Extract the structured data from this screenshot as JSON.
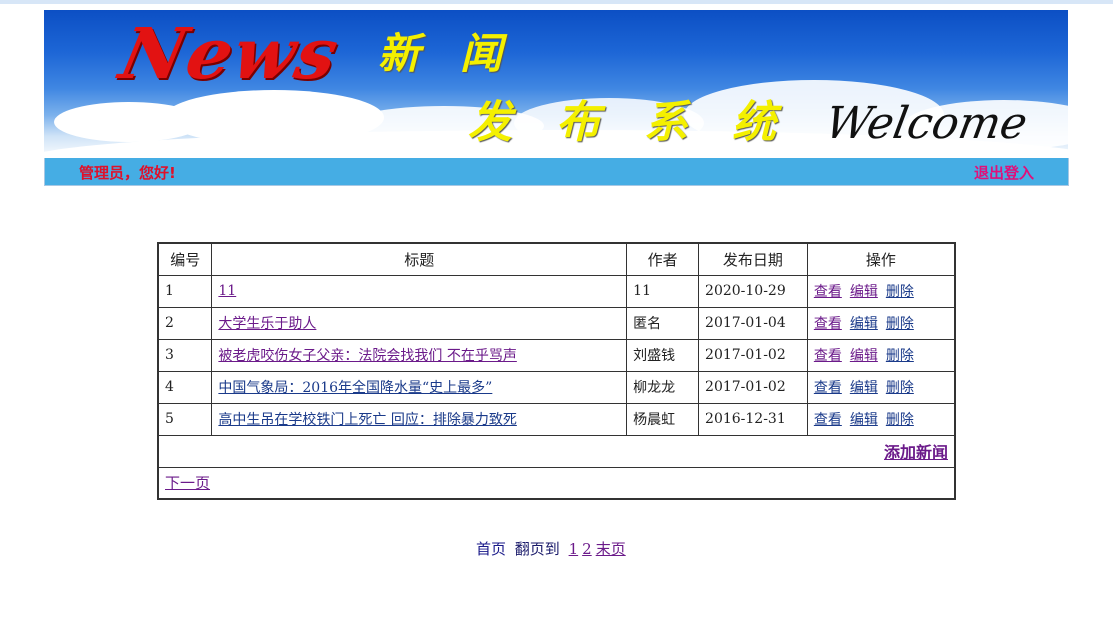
{
  "header": {
    "logo_text": "News",
    "title_line1": [
      "新",
      "闻"
    ],
    "title_line2": [
      "发",
      "布",
      "系",
      "统"
    ],
    "welcome_text": "Welcome"
  },
  "userbar": {
    "greeting": "管理员，您好!",
    "logout": "退出登入"
  },
  "table": {
    "headers": [
      "编号",
      "标题",
      "作者",
      "发布日期",
      "操作"
    ],
    "rows": [
      {
        "id": "1",
        "title": "11",
        "author": "11",
        "date": "2020-10-29"
      },
      {
        "id": "2",
        "title": "大学生乐于助人",
        "author": "匿名",
        "date": "2017-01-04"
      },
      {
        "id": "3",
        "title": "被老虎咬伤女子父亲：法院会找我们 不在乎骂声",
        "author": "刘盛钱",
        "date": "2017-01-02"
      },
      {
        "id": "4",
        "title": "中国气象局：2016年全国降水量“史上最多”",
        "author": "柳龙龙",
        "date": "2017-01-02"
      },
      {
        "id": "5",
        "title": "高中生吊在学校铁门上死亡 回应：排除暴力致死",
        "author": "杨晨虹",
        "date": "2016-12-31"
      }
    ],
    "ops": {
      "view": "查看",
      "edit": "编辑",
      "delete": "删除"
    },
    "add_news": "添加新闻",
    "next_page": "下一页"
  },
  "pager": {
    "first": "首页",
    "jump_label": "翻页到",
    "pages": [
      "1",
      "2"
    ],
    "last": "末页"
  },
  "colors": {
    "userbar_bg": "#45ade4",
    "greeting": "#e0102a",
    "logout": "#e0107a",
    "visited_link": "#6b1a8a",
    "link": "#1a3a8a"
  }
}
